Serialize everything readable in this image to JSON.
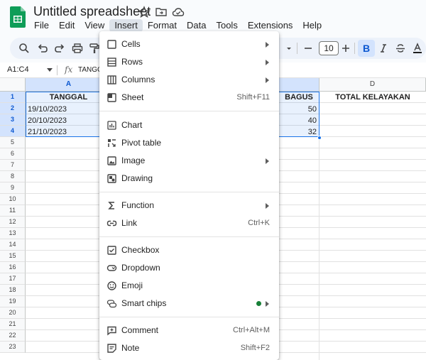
{
  "window": {
    "title": "Untitled spreadsheet"
  },
  "menubar": {
    "items": [
      "File",
      "Edit",
      "View",
      "Insert",
      "Format",
      "Data",
      "Tools",
      "Extensions",
      "Help"
    ]
  },
  "toolbar": {
    "font_size": "10",
    "bold_label": "B"
  },
  "formula_bar": {
    "name_box": "A1:C4",
    "fx_label": "fx",
    "content": "TANGG"
  },
  "sheet": {
    "columns": [
      "A",
      "D"
    ],
    "rows": [
      "1",
      "2",
      "3",
      "4",
      "5",
      "6",
      "7",
      "8",
      "9",
      "10",
      "11",
      "12",
      "13",
      "14",
      "15",
      "16",
      "17",
      "18",
      "19",
      "20",
      "21",
      "22",
      "23"
    ],
    "cells": {
      "a1": "TANGGAL",
      "c1_partial": "BAGUS",
      "d1": "TOTAL KELAYAKAN",
      "a2": "19/10/2023",
      "a3": "20/10/2023",
      "a4": "21/10/2023",
      "c2": "50",
      "c3": "40",
      "c4": "32"
    }
  },
  "insert_menu": {
    "cells": "Cells",
    "rows": "Rows",
    "columns": "Columns",
    "sheet": "Sheet",
    "sheet_shortcut": "Shift+F11",
    "chart": "Chart",
    "pivot_table": "Pivot table",
    "image": "Image",
    "drawing": "Drawing",
    "function": "Function",
    "link": "Link",
    "link_shortcut": "Ctrl+K",
    "checkbox": "Checkbox",
    "dropdown": "Dropdown",
    "emoji": "Emoji",
    "smart_chips": "Smart chips",
    "comment": "Comment",
    "comment_shortcut": "Ctrl+Alt+M",
    "note": "Note",
    "note_shortcut": "Shift+F2"
  },
  "colors": {
    "accent": "#1a73e8",
    "highlight": "#e00000",
    "sheets_green": "#0f9d58"
  }
}
